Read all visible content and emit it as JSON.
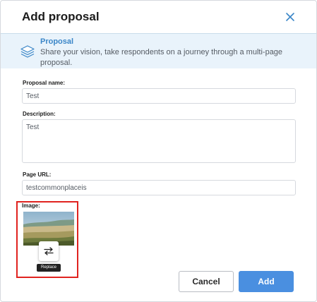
{
  "modal": {
    "title": "Add proposal",
    "close_icon": "close-x-icon"
  },
  "banner": {
    "icon": "layers-icon",
    "title": "Proposal",
    "description": "Share your vision, take respondents on a journey through a multi-page proposal."
  },
  "form": {
    "name": {
      "label": "Proposal name:",
      "value": "Test"
    },
    "description": {
      "label": "Description:",
      "value": "Test"
    },
    "url": {
      "label": "Page URL:",
      "value": "testcommonplaceis"
    },
    "image": {
      "label": "Image:",
      "replace_icon": "swap-arrows-icon",
      "tooltip": "Replace"
    }
  },
  "actions": {
    "cancel_label": "Cancel",
    "add_label": "Add"
  },
  "colors": {
    "accent": "#4a8fe0",
    "banner_bg": "#e9f3fb",
    "banner_title": "#3a86c8",
    "highlight": "#e0231f"
  }
}
